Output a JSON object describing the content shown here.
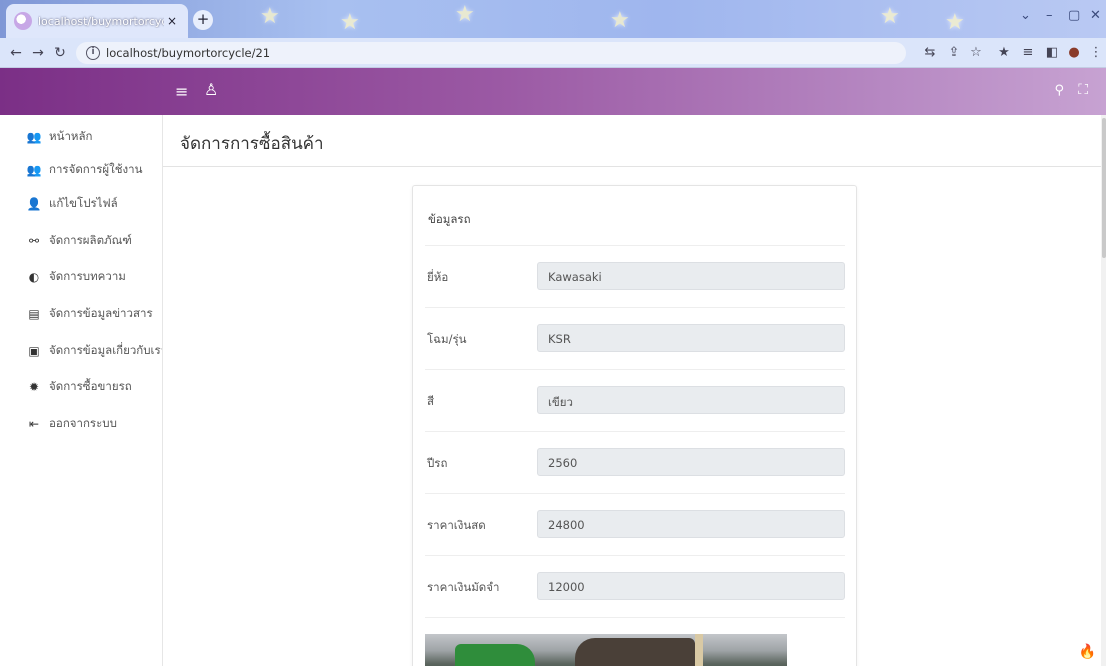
{
  "browser": {
    "tab_title": "localhost/buymortorcycle/21",
    "url": "localhost/buymortorcycle/21",
    "close_tab": "×",
    "new_tab": "+"
  },
  "sidebar": {
    "items": [
      {
        "icon": "users-icon",
        "label": "หน้าหลัก"
      },
      {
        "icon": "users-icon",
        "label": "การจัดการผู้ใช้งาน"
      },
      {
        "icon": "user-edit-icon",
        "label": "แก้ไขโปรไฟล์"
      },
      {
        "icon": "sitemap-icon",
        "label": "จัดการผลิตภัณฑ์"
      },
      {
        "icon": "contrast-icon",
        "label": "จัดการบทความ"
      },
      {
        "icon": "newspaper-icon",
        "label": "จัดการข้อมูลข่าวสาร"
      },
      {
        "icon": "info-book-icon",
        "label": "จัดการข้อมูลเกี่ยวกับเรา"
      },
      {
        "icon": "gear-icon",
        "label": "จัดการซื้อขายรถ"
      },
      {
        "icon": "logout-icon",
        "label": "ออกจากระบบ"
      }
    ]
  },
  "page": {
    "title": "จัดการการซื้อสินค้า"
  },
  "card": {
    "title": "ข้อมูลรถ",
    "fields": [
      {
        "label": "ยี่ห้อ",
        "value": "Kawasaki"
      },
      {
        "label": "โฉม/รุ่น",
        "value": "KSR"
      },
      {
        "label": "สี",
        "value": "เขียว"
      },
      {
        "label": "ปีรถ",
        "value": "2560"
      },
      {
        "label": "ราคาเงินสด",
        "value": "24800"
      },
      {
        "label": "ราคาเงินมัดจำ",
        "value": "12000"
      }
    ]
  },
  "colors": {
    "header_start": "#7b2f86",
    "header_end": "#c7a2d2"
  }
}
